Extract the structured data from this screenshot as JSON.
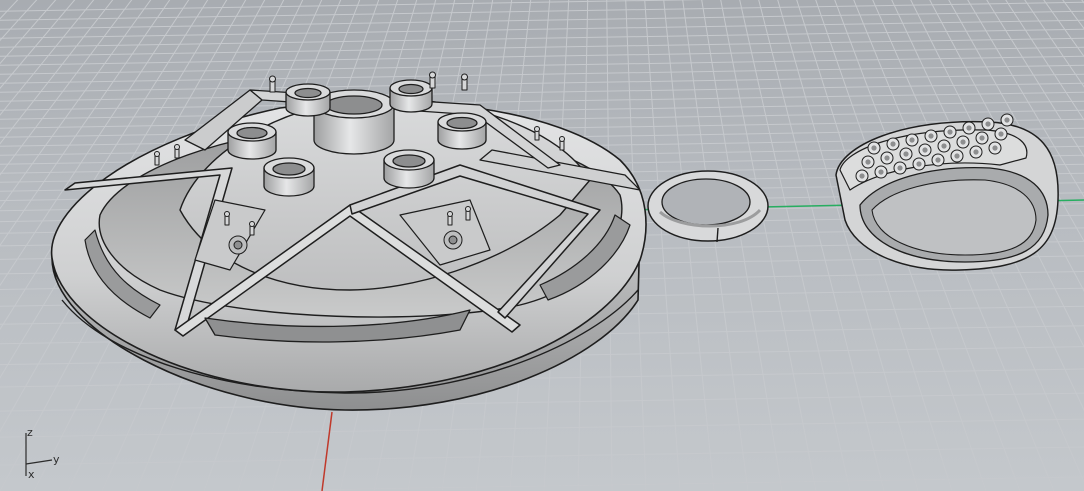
{
  "viewport": {
    "name": "Perspective",
    "background": "#b3b7bc",
    "grid_color": "#c6c9cd",
    "axes_colors": {
      "x": "#c0392b",
      "y": "#27ae60"
    }
  },
  "axis_widget": {
    "z_label": "z",
    "y_label": "y",
    "x_label": "x"
  },
  "model": {
    "objects": [
      "pendant-star-body",
      "jump-ring",
      "bail-with-stones"
    ],
    "surface_color": "#d3d4d5",
    "edge_color": "#1e1e1e"
  }
}
